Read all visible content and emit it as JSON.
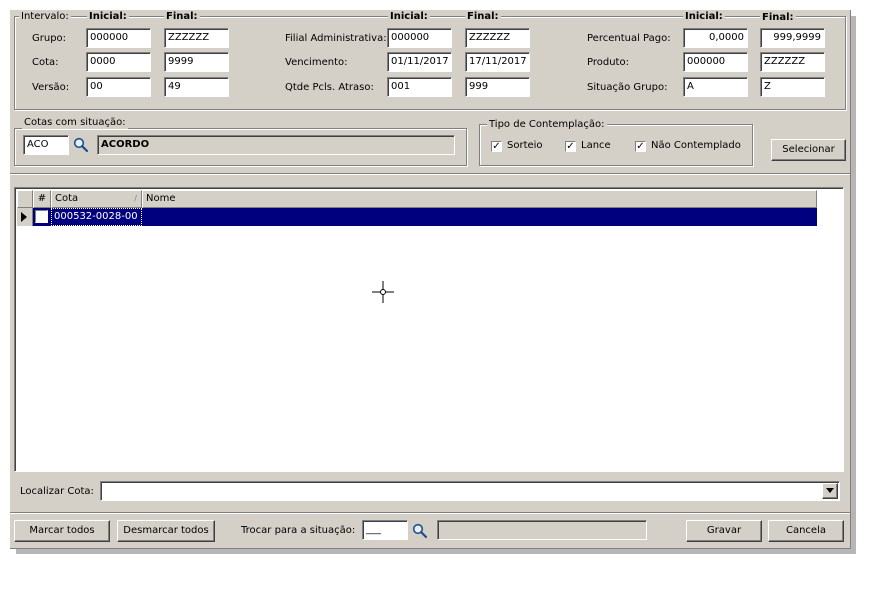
{
  "interval": {
    "legend": "Intervalo:",
    "inicial_label": "Inicial:",
    "final_label": "Final:",
    "grupo_label": "Grupo:",
    "grupo_inicial": "000000",
    "grupo_final": "ZZZZZZ",
    "cota_label": "Cota:",
    "cota_inicial": "0000",
    "cota_final": "9999",
    "versao_label": "Versão:",
    "versao_inicial": "00",
    "versao_final": "49",
    "filial_label": "Filial Administrativa:",
    "filial_inicial": "000000",
    "filial_final": "ZZZZZZ",
    "vencimento_label": "Vencimento:",
    "vencimento_inicial": "01/11/2017",
    "vencimento_final": "17/11/2017",
    "qtde_label": "Qtde Pcls. Atraso:",
    "qtde_inicial": "001",
    "qtde_final": "999",
    "percentual_label": "Percentual Pago:",
    "percentual_inicial": "0,0000",
    "percentual_final": "999,9999",
    "produto_label": "Produto:",
    "produto_inicial": "000000",
    "produto_final": "ZZZZZZ",
    "situacao_label": "Situação Grupo:",
    "situacao_inicial": "A",
    "situacao_final": "Z"
  },
  "cotas_situacao": {
    "legend": "Cotas com situação:",
    "code": "ACO",
    "description": "ACORDO"
  },
  "contemplacao": {
    "legend": "Tipo de Contemplação:",
    "sorteio": "Sorteio",
    "lance": "Lance",
    "nao_contemplado": "Não Contemplado",
    "check_mark": "✓"
  },
  "select_button": "Selecionar",
  "grid": {
    "col_hash": "#",
    "col_cota": "Cota",
    "col_nome": "Nome",
    "rows": [
      {
        "cota": "000532-0028-00",
        "nome": ""
      }
    ]
  },
  "localizar": {
    "label": "Localizar Cota:",
    "value": ""
  },
  "bottom": {
    "marcar_todos": "Marcar todos",
    "desmarcar_todos": "Desmarcar todos",
    "trocar_label": "Trocar para a situação:",
    "trocar_code": "___",
    "trocar_desc": "",
    "gravar": "Gravar",
    "cancela": "Cancela"
  },
  "colors": {
    "selection": "#00007f",
    "window": "#d4d0c8"
  }
}
